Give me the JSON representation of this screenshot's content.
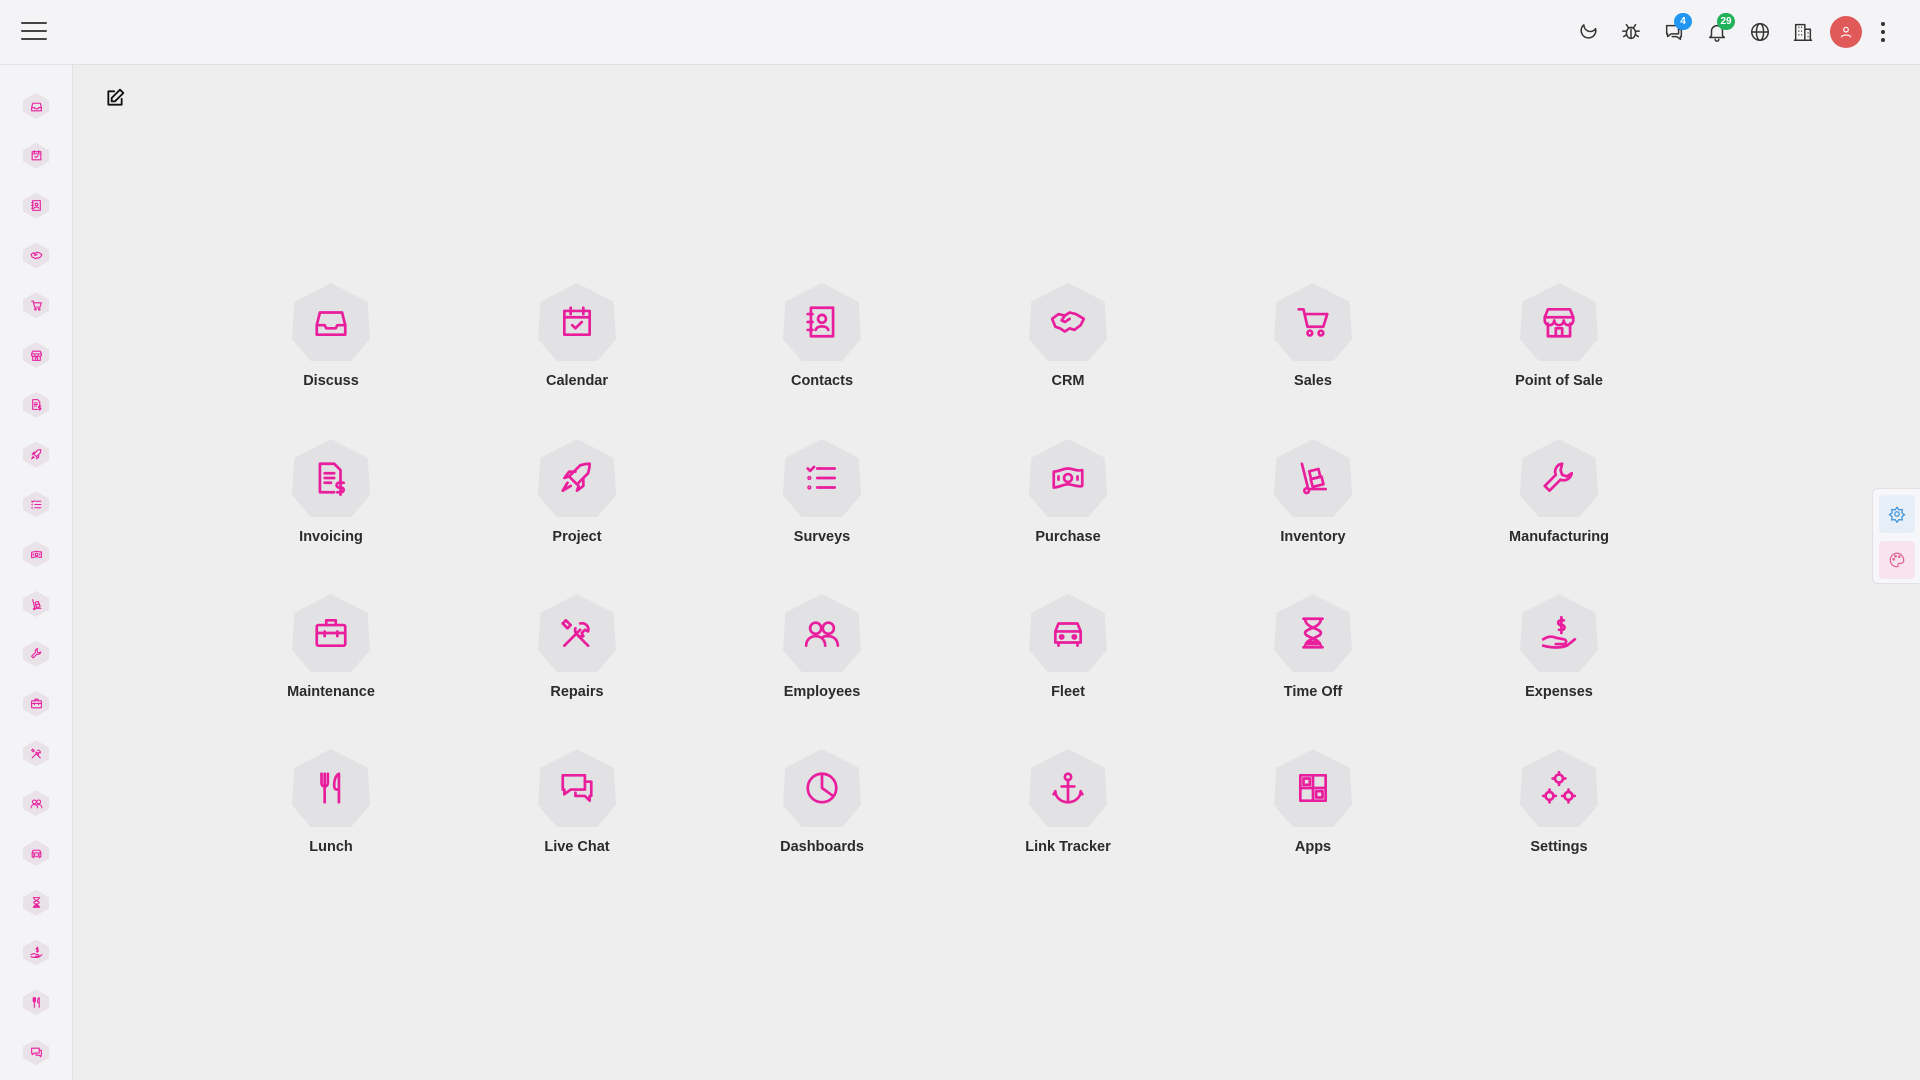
{
  "colors": {
    "accent": "#e91e9d",
    "badge_chat": "#2196f3",
    "badge_notifications": "#1fb25a",
    "avatar": "#e05a5a"
  },
  "topbar": {
    "chat_badge": "4",
    "notifications_badge": "29",
    "icons": [
      "hamburger-menu-icon",
      "moon-icon",
      "bug-icon",
      "chat-icon",
      "bell-icon",
      "globe-icon",
      "building-icon",
      "avatar",
      "kebab-menu-icon"
    ]
  },
  "apps": [
    {
      "label": "Discuss",
      "icon": "inbox-icon"
    },
    {
      "label": "Calendar",
      "icon": "calendar-check-icon"
    },
    {
      "label": "Contacts",
      "icon": "address-book-icon"
    },
    {
      "label": "CRM",
      "icon": "handshake-icon"
    },
    {
      "label": "Sales",
      "icon": "cart-icon"
    },
    {
      "label": "Point of Sale",
      "icon": "storefront-icon"
    },
    {
      "label": "Invoicing",
      "icon": "invoice-dollar-icon"
    },
    {
      "label": "Project",
      "icon": "rocket-icon"
    },
    {
      "label": "Surveys",
      "icon": "checklist-icon"
    },
    {
      "label": "Purchase",
      "icon": "cash-icon"
    },
    {
      "label": "Inventory",
      "icon": "dolly-icon"
    },
    {
      "label": "Manufacturing",
      "icon": "wrench-icon"
    },
    {
      "label": "Maintenance",
      "icon": "toolbox-icon"
    },
    {
      "label": "Repairs",
      "icon": "tools-icon"
    },
    {
      "label": "Employees",
      "icon": "users-icon"
    },
    {
      "label": "Fleet",
      "icon": "car-icon"
    },
    {
      "label": "Time Off",
      "icon": "hourglass-icon"
    },
    {
      "label": "Expenses",
      "icon": "hand-dollar-icon"
    },
    {
      "label": "Lunch",
      "icon": "fork-knife-icon"
    },
    {
      "label": "Live Chat",
      "icon": "chat-bubbles-icon"
    },
    {
      "label": "Dashboards",
      "icon": "pie-chart-icon"
    },
    {
      "label": "Link Tracker",
      "icon": "anchor-icon"
    },
    {
      "label": "Apps",
      "icon": "grid-apps-icon"
    },
    {
      "label": "Settings",
      "icon": "gears-icon"
    }
  ],
  "sidebar_icons": [
    "inbox-icon",
    "calendar-check-icon",
    "address-book-icon",
    "handshake-icon",
    "cart-icon",
    "storefront-icon",
    "invoice-dollar-icon",
    "rocket-icon",
    "checklist-icon",
    "cash-icon",
    "dolly-icon",
    "wrench-icon",
    "toolbox-icon",
    "tools-icon",
    "users-icon",
    "car-icon",
    "hourglass-icon",
    "hand-dollar-icon",
    "fork-knife-icon",
    "chat-bubbles-icon"
  ],
  "float_panel": [
    "settings-flower-icon",
    "palette-icon"
  ]
}
